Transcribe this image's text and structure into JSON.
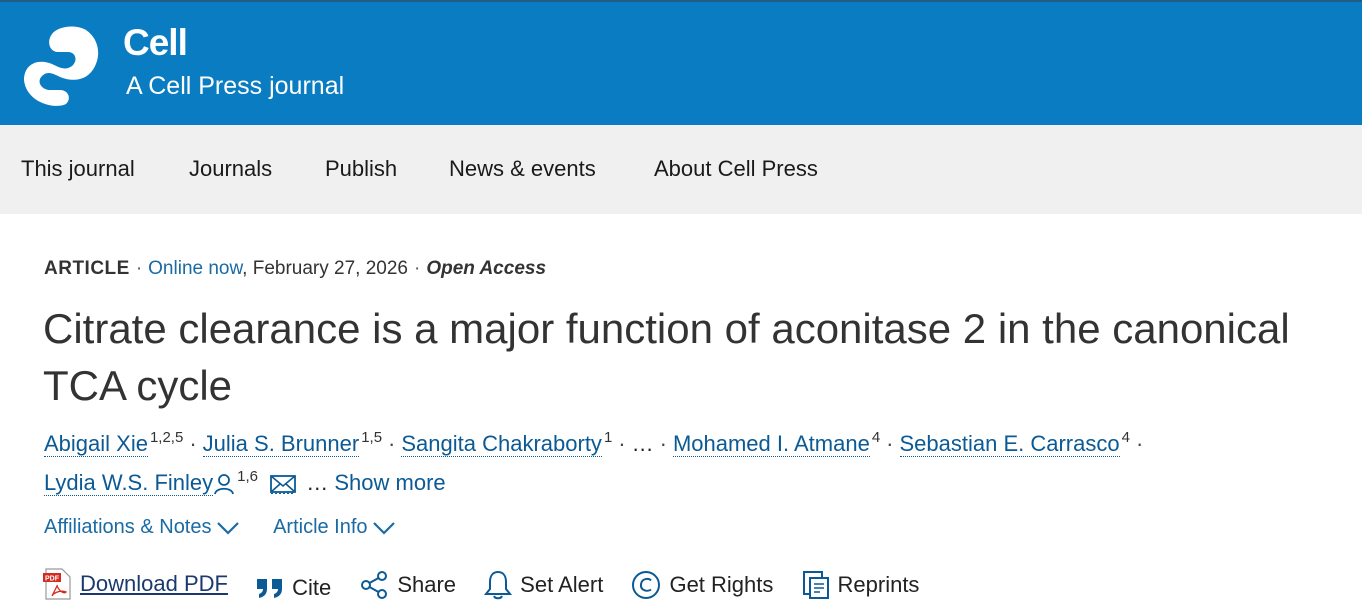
{
  "brand": {
    "name": "Cell",
    "subtitle": "A Cell Press journal",
    "color": "#0a7dc2"
  },
  "nav": [
    "This journal",
    "Journals",
    "Publish",
    "News & events",
    "About Cell Press"
  ],
  "article": {
    "type": "ARTICLE",
    "online": "Online now",
    "date": ", February 27, 2026",
    "access": "Open Access",
    "title": "Citrate clearance is a major function of aconitase 2 in the canonical TCA cycle"
  },
  "authors": [
    {
      "name": "Abigail Xie",
      "sup": "1,2,5"
    },
    {
      "name": "Julia S. Brunner",
      "sup": "1,5"
    },
    {
      "name": "Sangita Chakraborty",
      "sup": "1"
    },
    {
      "name": "Mohamed I. Atmane",
      "sup": "4"
    },
    {
      "name": "Sebastian E. Carrasco",
      "sup": "4"
    },
    {
      "name": "Lydia W.S. Finley",
      "sup": "1,6"
    }
  ],
  "ellipsis": "…",
  "show_more": "Show more",
  "toggles": {
    "affiliations": "Affiliations & Notes",
    "info": "Article Info"
  },
  "actions": {
    "download_pdf": "Download PDF",
    "cite": "Cite",
    "share": "Share",
    "set_alert": "Set Alert",
    "get_rights": "Get Rights",
    "reprints": "Reprints"
  },
  "icons": {
    "logo": "cell-logo-icon",
    "pdf": "pdf-file-icon",
    "cite": "quote-icon",
    "share": "share-icon",
    "alert": "bell-icon",
    "rights": "copyright-icon",
    "reprints": "reprints-icon",
    "person": "person-icon",
    "email": "email-icon",
    "chevron": "chevron-down-icon"
  }
}
